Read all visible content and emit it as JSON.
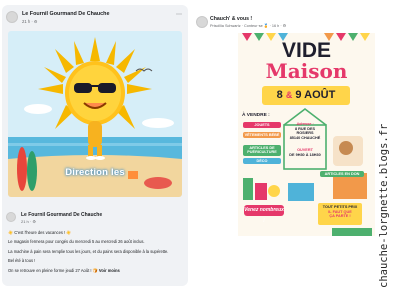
{
  "left_post": {
    "author": "Le Fournil Gourmand De Chauche",
    "meta": "21 h · ⚙",
    "image": {
      "banner_text": "Direction les",
      "description": "cartoon sun with sunglasses on a beach"
    },
    "shared": {
      "author": "Le Fournil Gourmand De Chauche",
      "meta": "21 h · ⚙",
      "lines": [
        "☀️ C'est l'heure des vacances ! ☀️",
        "Le magasin fermera pour congés du mercredi 5 au mercredi 26 août inclus.",
        "La machine à pain sera remplie tous les jours, et du pains sera disponible à la supérette.",
        "Bel été à tous !",
        "On se retrouve en pleine forme jeudi 27 Août ! 🍞"
      ],
      "see_more": "Voir moins"
    }
  },
  "right_post": {
    "author": "Chauch' & vous !",
    "meta": "Priscillia Schwartz · Conteur·se 🏅 · 16 h · ⚙",
    "poster": {
      "title_1": "VIDE",
      "title_2": "Maison",
      "date_part1": "8",
      "date_amp": "&",
      "date_part2": "9 AOÛT",
      "a_vendre": "À VENDRE :",
      "tags": [
        "JOUETS",
        "VÊTEMENTS BÉBÉ",
        "ARTICLES DE PUÉRICULTURE",
        "DÉCO"
      ],
      "adresse_label": "Adresse :",
      "adresse_lines": [
        "8 RUE DES ROSIERS",
        "85140 CHAUCHÉ"
      ],
      "ouvert_label": "OUVERT",
      "ouvert_lines": [
        "DE 9H30 À 18H30"
      ],
      "articles_en_don": "ARTICLES EN DON",
      "venez": "Venez nombreux !",
      "tout_lines": [
        "TOUT PETITS PRIX",
        "IL FAUT QUE",
        "ÇA PARTE !"
      ]
    }
  },
  "watermark": "chauche-lorgnette.blogs.fr",
  "colors": {
    "pink": "#e5386a",
    "yellow": "#ffd54a",
    "green": "#4db06e",
    "orange": "#f2994a",
    "sky": "#d4ecf7",
    "sea": "#4fb3d9"
  },
  "icons": [
    "more-icon",
    "globe-icon",
    "sun-icon",
    "surfboard-icon",
    "house-icon"
  ]
}
